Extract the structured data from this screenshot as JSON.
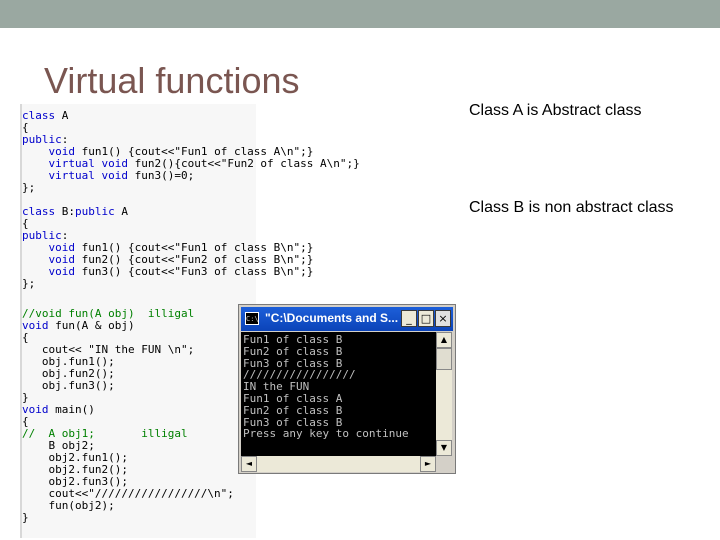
{
  "slide": {
    "title": "Virtual functions",
    "note_a": "Class A is Abstract class",
    "note_b": "Class B is non abstract class"
  },
  "colors": {
    "header_bar": "#9aa8a1",
    "title_text": "#7a5651",
    "keyword": "#0000cc",
    "comment": "#008000",
    "titlebar": "#0b43b8"
  },
  "code_lines": [
    [
      {
        "t": "class",
        "c": "kw"
      },
      {
        "t": " A"
      }
    ],
    [
      {
        "t": "{"
      }
    ],
    [
      {
        "t": "public",
        "c": "kw"
      },
      {
        "t": ":"
      }
    ],
    [
      {
        "t": "    "
      },
      {
        "t": "void",
        "c": "kw"
      },
      {
        "t": " fun1() {cout<<\"Fun1 of class A\\n\";}"
      }
    ],
    [
      {
        "t": "    "
      },
      {
        "t": "virtual void",
        "c": "kw"
      },
      {
        "t": " fun2(){cout<<\"Fun2 of class A\\n\";}"
      }
    ],
    [
      {
        "t": "    "
      },
      {
        "t": "virtual void",
        "c": "kw"
      },
      {
        "t": " fun3()=0;"
      }
    ],
    [
      {
        "t": "};"
      }
    ],
    [
      {
        "t": "class",
        "c": "kw"
      },
      {
        "t": " B:"
      },
      {
        "t": "public",
        "c": "kw"
      },
      {
        "t": " A"
      }
    ],
    [
      {
        "t": "{"
      }
    ],
    [
      {
        "t": "public",
        "c": "kw"
      },
      {
        "t": ":"
      }
    ],
    [
      {
        "t": "    "
      },
      {
        "t": "void",
        "c": "kw"
      },
      {
        "t": " fun1() {cout<<\"Fun1 of class B\\n\";}"
      }
    ],
    [
      {
        "t": "    "
      },
      {
        "t": "void",
        "c": "kw"
      },
      {
        "t": " fun2() {cout<<\"Fun2 of class B\\n\";}"
      }
    ],
    [
      {
        "t": "    "
      },
      {
        "t": "void",
        "c": "kw"
      },
      {
        "t": " fun3() {cout<<\"Fun3 of class B\\n\";}"
      }
    ],
    [
      {
        "t": "};"
      }
    ],
    [
      {
        "t": "//void fun(A obj)  illigal",
        "c": "cm"
      }
    ],
    [
      {
        "t": "void",
        "c": "kw"
      },
      {
        "t": " fun(A & obj)"
      }
    ],
    [
      {
        "t": "{"
      }
    ],
    [
      {
        "t": "   cout<< \"IN the FUN \\n\";"
      }
    ],
    [
      {
        "t": "   obj.fun1();"
      }
    ],
    [
      {
        "t": "   obj.fun2();"
      }
    ],
    [
      {
        "t": "   obj.fun3();"
      }
    ],
    [
      {
        "t": "}"
      }
    ],
    [
      {
        "t": "void",
        "c": "kw"
      },
      {
        "t": " main()"
      }
    ],
    [
      {
        "t": "{"
      }
    ],
    [
      {
        "t": "//  A obj1;       illigal",
        "c": "cm"
      }
    ],
    [
      {
        "t": "    B obj2;"
      }
    ],
    [
      {
        "t": "    obj2.fun1();"
      }
    ],
    [
      {
        "t": "    obj2.fun2();"
      }
    ],
    [
      {
        "t": "    obj2.fun3();"
      }
    ],
    [
      {
        "t": "    cout<<\"/////////////////\\n\";"
      }
    ],
    [
      {
        "t": "    fun(obj2);"
      }
    ],
    [
      {
        "t": "}"
      }
    ]
  ],
  "console": {
    "title": "\"C:\\Documents and S...",
    "icon_label": "C:\\",
    "minimize": "_",
    "maximize": "□",
    "close": "×",
    "scroll_up": "▲",
    "scroll_down": "▼",
    "scroll_left": "◄",
    "scroll_right": "►",
    "output": [
      "Fun1 of class B",
      "Fun2 of class B",
      "Fun3 of class B",
      "/////////////////",
      "IN the FUN",
      "Fun1 of class A",
      "Fun2 of class B",
      "Fun3 of class B",
      "Press any key to continue"
    ]
  }
}
